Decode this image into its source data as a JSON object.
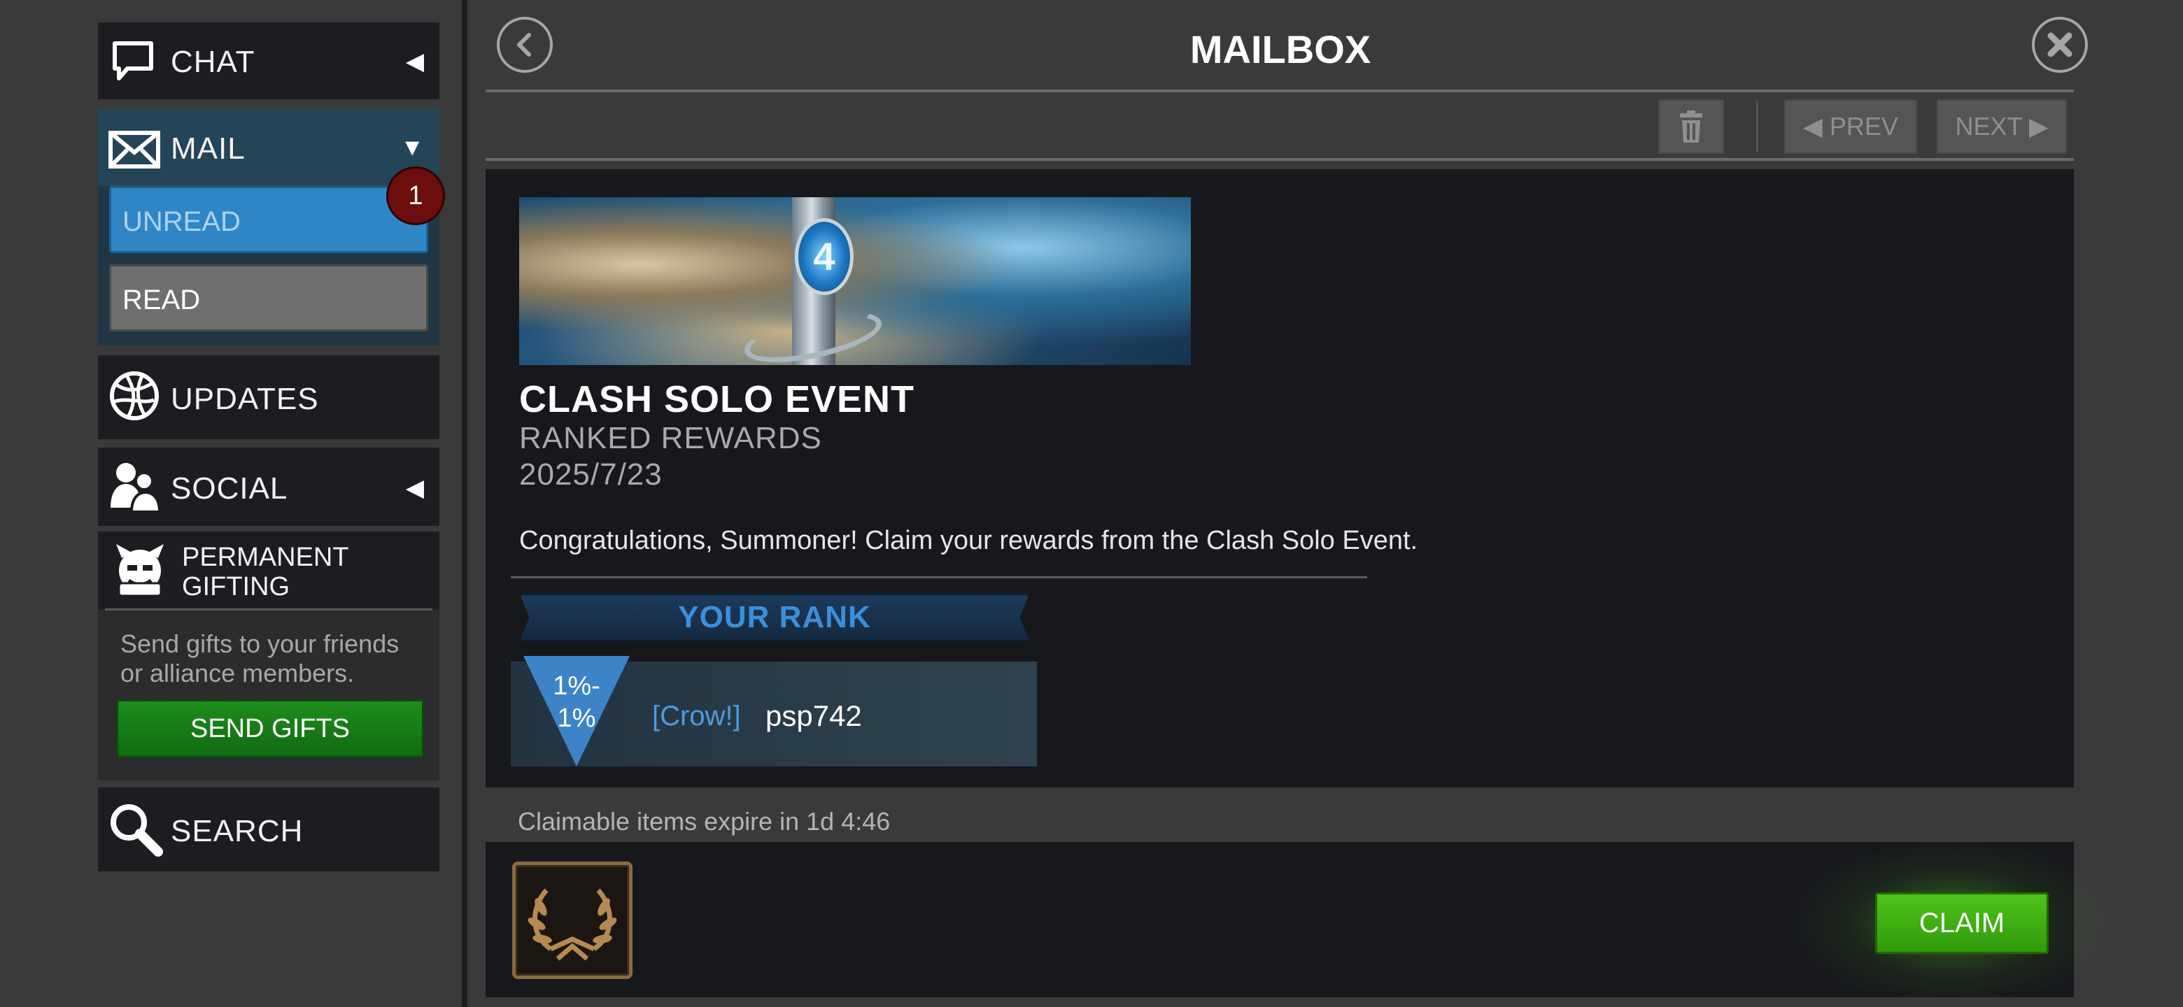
{
  "sidebar": {
    "chat": {
      "label": "CHAT",
      "icon": "chat-bubble-icon"
    },
    "mail": {
      "label": "MAIL",
      "icon": "envelope-icon",
      "unread_label": "UNREAD",
      "read_label": "READ",
      "unread_count": "1"
    },
    "updates": {
      "label": "UPDATES",
      "icon": "globe-icon"
    },
    "social": {
      "label": "SOCIAL",
      "icon": "people-icon"
    },
    "gifting": {
      "title_line1": "PERMANENT",
      "title_line2": "GIFTING",
      "icon": "gift-character-icon",
      "description": "Send gifts to your friends or alliance members.",
      "send_button": "SEND GIFTS"
    },
    "search": {
      "label": "SEARCH",
      "icon": "magnifier-icon"
    }
  },
  "header": {
    "title": "MAILBOX",
    "prev_label": "◀ PREV",
    "next_label": "NEXT ▶"
  },
  "message": {
    "title": "CLASH SOLO EVENT",
    "subtitle": "RANKED REWARDS",
    "date": "2025/7/23",
    "body": "Congratulations, Summoner! Claim your rewards from the Clash Solo Event.",
    "rank_heading": "YOUR RANK",
    "rank_line1": "1%-",
    "rank_line2": "1%",
    "alliance_tag": "[Crow!]",
    "player_name": "psp742",
    "banner_logo": "4"
  },
  "claim": {
    "expire_text": "Claimable items expire in 1d 4:46",
    "claim_label": "CLAIM",
    "item_icon": "laurel-wreath-icon"
  },
  "colors": {
    "background": "#3a3a3a",
    "panel": "#17181c",
    "accent_blue": "#2f86c7",
    "claim_green": "#3fae12",
    "send_green": "#178017",
    "badge_red": "#6e0d0d"
  }
}
